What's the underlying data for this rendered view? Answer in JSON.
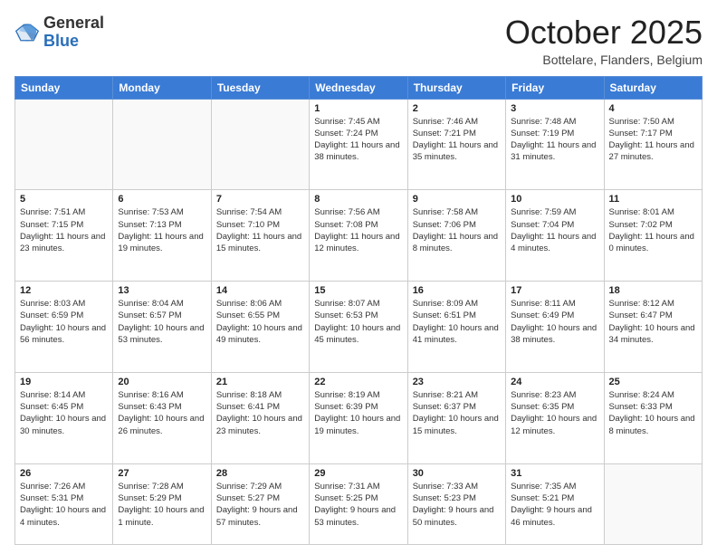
{
  "header": {
    "logo_general": "General",
    "logo_blue": "Blue",
    "month": "October 2025",
    "location": "Bottelare, Flanders, Belgium"
  },
  "weekdays": [
    "Sunday",
    "Monday",
    "Tuesday",
    "Wednesday",
    "Thursday",
    "Friday",
    "Saturday"
  ],
  "rows": [
    [
      {
        "day": "",
        "info": ""
      },
      {
        "day": "",
        "info": ""
      },
      {
        "day": "",
        "info": ""
      },
      {
        "day": "1",
        "info": "Sunrise: 7:45 AM\nSunset: 7:24 PM\nDaylight: 11 hours and 38 minutes."
      },
      {
        "day": "2",
        "info": "Sunrise: 7:46 AM\nSunset: 7:21 PM\nDaylight: 11 hours and 35 minutes."
      },
      {
        "day": "3",
        "info": "Sunrise: 7:48 AM\nSunset: 7:19 PM\nDaylight: 11 hours and 31 minutes."
      },
      {
        "day": "4",
        "info": "Sunrise: 7:50 AM\nSunset: 7:17 PM\nDaylight: 11 hours and 27 minutes."
      }
    ],
    [
      {
        "day": "5",
        "info": "Sunrise: 7:51 AM\nSunset: 7:15 PM\nDaylight: 11 hours and 23 minutes."
      },
      {
        "day": "6",
        "info": "Sunrise: 7:53 AM\nSunset: 7:13 PM\nDaylight: 11 hours and 19 minutes."
      },
      {
        "day": "7",
        "info": "Sunrise: 7:54 AM\nSunset: 7:10 PM\nDaylight: 11 hours and 15 minutes."
      },
      {
        "day": "8",
        "info": "Sunrise: 7:56 AM\nSunset: 7:08 PM\nDaylight: 11 hours and 12 minutes."
      },
      {
        "day": "9",
        "info": "Sunrise: 7:58 AM\nSunset: 7:06 PM\nDaylight: 11 hours and 8 minutes."
      },
      {
        "day": "10",
        "info": "Sunrise: 7:59 AM\nSunset: 7:04 PM\nDaylight: 11 hours and 4 minutes."
      },
      {
        "day": "11",
        "info": "Sunrise: 8:01 AM\nSunset: 7:02 PM\nDaylight: 11 hours and 0 minutes."
      }
    ],
    [
      {
        "day": "12",
        "info": "Sunrise: 8:03 AM\nSunset: 6:59 PM\nDaylight: 10 hours and 56 minutes."
      },
      {
        "day": "13",
        "info": "Sunrise: 8:04 AM\nSunset: 6:57 PM\nDaylight: 10 hours and 53 minutes."
      },
      {
        "day": "14",
        "info": "Sunrise: 8:06 AM\nSunset: 6:55 PM\nDaylight: 10 hours and 49 minutes."
      },
      {
        "day": "15",
        "info": "Sunrise: 8:07 AM\nSunset: 6:53 PM\nDaylight: 10 hours and 45 minutes."
      },
      {
        "day": "16",
        "info": "Sunrise: 8:09 AM\nSunset: 6:51 PM\nDaylight: 10 hours and 41 minutes."
      },
      {
        "day": "17",
        "info": "Sunrise: 8:11 AM\nSunset: 6:49 PM\nDaylight: 10 hours and 38 minutes."
      },
      {
        "day": "18",
        "info": "Sunrise: 8:12 AM\nSunset: 6:47 PM\nDaylight: 10 hours and 34 minutes."
      }
    ],
    [
      {
        "day": "19",
        "info": "Sunrise: 8:14 AM\nSunset: 6:45 PM\nDaylight: 10 hours and 30 minutes."
      },
      {
        "day": "20",
        "info": "Sunrise: 8:16 AM\nSunset: 6:43 PM\nDaylight: 10 hours and 26 minutes."
      },
      {
        "day": "21",
        "info": "Sunrise: 8:18 AM\nSunset: 6:41 PM\nDaylight: 10 hours and 23 minutes."
      },
      {
        "day": "22",
        "info": "Sunrise: 8:19 AM\nSunset: 6:39 PM\nDaylight: 10 hours and 19 minutes."
      },
      {
        "day": "23",
        "info": "Sunrise: 8:21 AM\nSunset: 6:37 PM\nDaylight: 10 hours and 15 minutes."
      },
      {
        "day": "24",
        "info": "Sunrise: 8:23 AM\nSunset: 6:35 PM\nDaylight: 10 hours and 12 minutes."
      },
      {
        "day": "25",
        "info": "Sunrise: 8:24 AM\nSunset: 6:33 PM\nDaylight: 10 hours and 8 minutes."
      }
    ],
    [
      {
        "day": "26",
        "info": "Sunrise: 7:26 AM\nSunset: 5:31 PM\nDaylight: 10 hours and 4 minutes."
      },
      {
        "day": "27",
        "info": "Sunrise: 7:28 AM\nSunset: 5:29 PM\nDaylight: 10 hours and 1 minute."
      },
      {
        "day": "28",
        "info": "Sunrise: 7:29 AM\nSunset: 5:27 PM\nDaylight: 9 hours and 57 minutes."
      },
      {
        "day": "29",
        "info": "Sunrise: 7:31 AM\nSunset: 5:25 PM\nDaylight: 9 hours and 53 minutes."
      },
      {
        "day": "30",
        "info": "Sunrise: 7:33 AM\nSunset: 5:23 PM\nDaylight: 9 hours and 50 minutes."
      },
      {
        "day": "31",
        "info": "Sunrise: 7:35 AM\nSunset: 5:21 PM\nDaylight: 9 hours and 46 minutes."
      },
      {
        "day": "",
        "info": ""
      }
    ]
  ]
}
